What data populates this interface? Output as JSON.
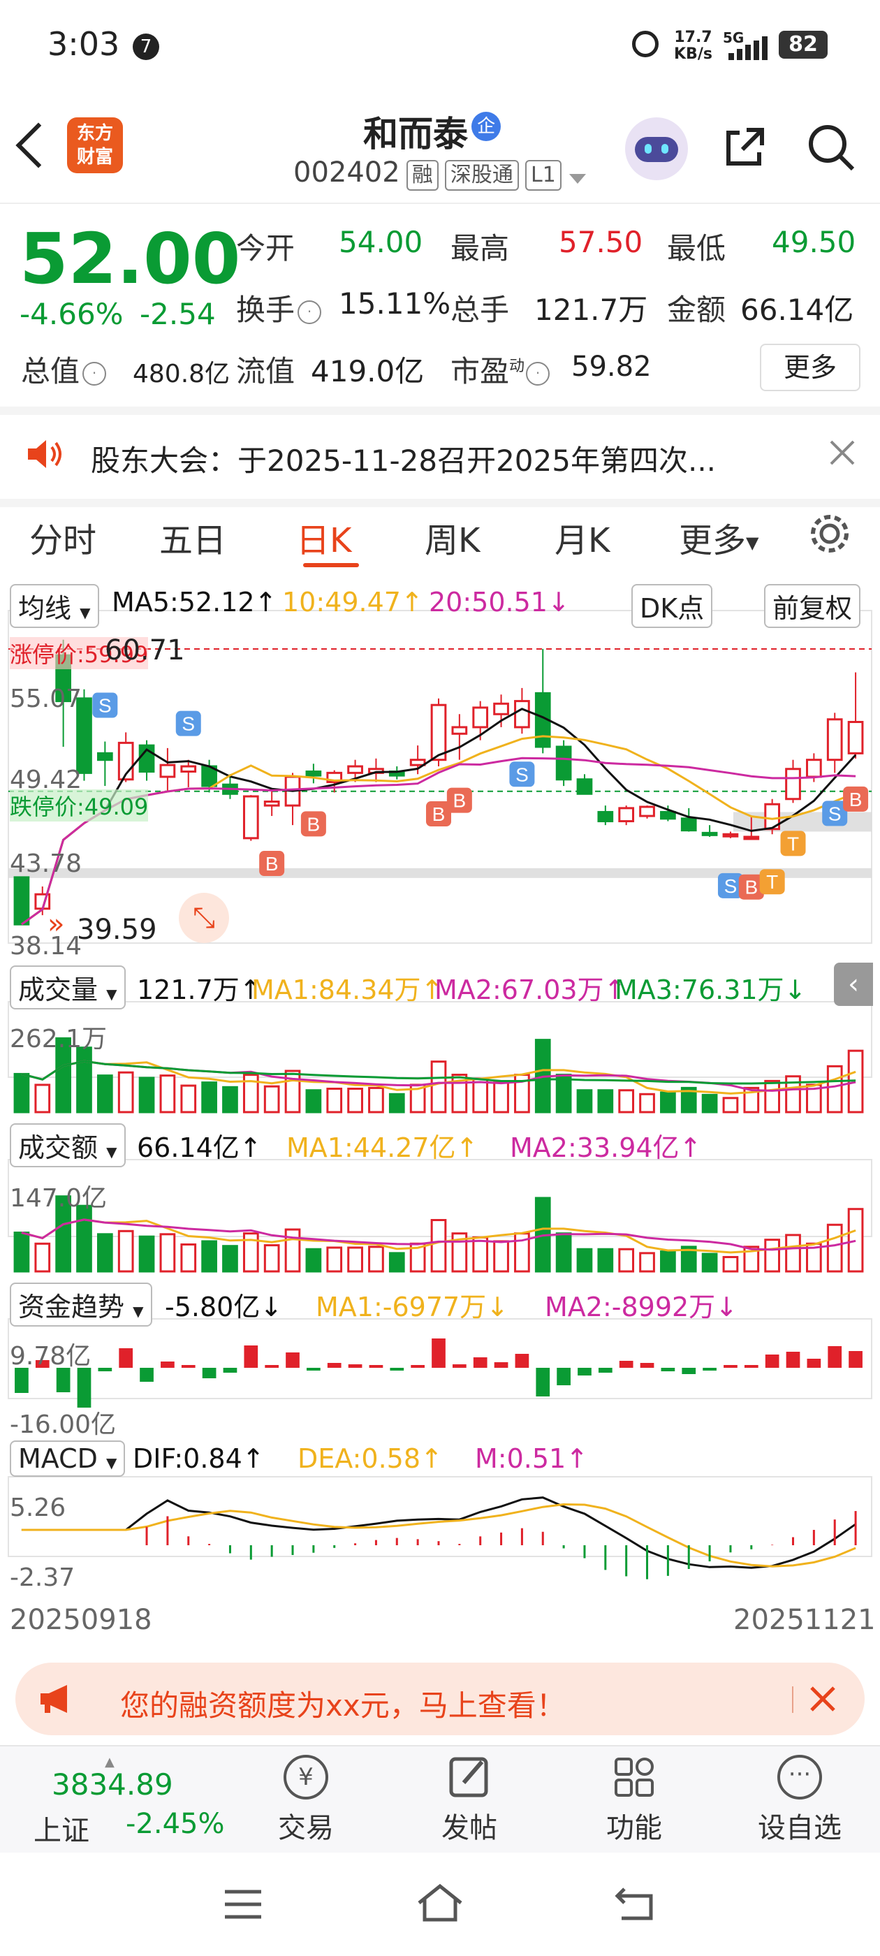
{
  "status_bar": {
    "time": "3:03",
    "notif_count": "7",
    "net_speed": "17.7",
    "net_unit": "KB/s",
    "network": "5G",
    "battery": "82"
  },
  "header": {
    "logo_line1": "东方",
    "logo_line2": "财富",
    "stock_name": "和而泰",
    "name_badge": "企",
    "stock_code": "002402",
    "tags": [
      "融",
      "深股通",
      "L1"
    ]
  },
  "quote": {
    "price": "52.00",
    "change_pct": "-4.66%",
    "change": "-2.54",
    "open_label": "今开",
    "open": "54.00",
    "high_label": "最高",
    "high": "57.50",
    "low_label": "最低",
    "low": "49.50",
    "turnover_label": "换手",
    "turnover": "15.11%",
    "volume_label": "总手",
    "volume": "121.7万",
    "amount_label": "金额",
    "amount": "66.14亿",
    "mcap_label": "总值",
    "mcap": "480.8亿",
    "float_label": "流值",
    "float": "419.0亿",
    "pe_label": "市盈",
    "pe_sup": "动",
    "pe": "59.82",
    "more_button": "更多"
  },
  "notice": {
    "text": "股东大会：于2025-11-28召开2025年第四次..."
  },
  "tabs": [
    "分时",
    "五日",
    "日K",
    "周K",
    "月K",
    "更多"
  ],
  "active_tab": "日K",
  "kchart": {
    "ma_selector": "均线",
    "ma5": "MA5:52.12",
    "ma5_arrow": "↑",
    "ma10": "10:49.47",
    "ma10_arrow": "↑",
    "ma20": "20:50.51",
    "ma20_arrow": "↓",
    "dk_button": "DK点",
    "adjust_button": "前复权",
    "limit_up_label": "涨停价:59.99",
    "limit_down_label": "跌停价:49.09",
    "y_ticks": [
      "60.71",
      "55.07",
      "49.42",
      "43.78",
      "38.14"
    ],
    "high_mark": "60.71",
    "low_mark": "39.59"
  },
  "volume_panel": {
    "selector": "成交量",
    "value": "121.7万",
    "value_arrow": "↑",
    "ma1": "MA1:84.34万",
    "ma1_arrow": "↑",
    "ma2": "MA2:67.03万",
    "ma2_arrow": "↑",
    "ma3": "MA3:76.31万",
    "ma3_arrow": "↓",
    "top_tick": "262.1万"
  },
  "amount_panel": {
    "selector": "成交额",
    "value": "66.14亿",
    "value_arrow": "↑",
    "ma1": "MA1:44.27亿",
    "ma1_arrow": "↑",
    "ma2": "MA2:33.94亿",
    "ma2_arrow": "↑",
    "top_tick": "147.0亿"
  },
  "fund_panel": {
    "selector": "资金趋势",
    "value": "-5.80亿",
    "value_arrow": "↓",
    "ma1": "MA1:-6977万",
    "ma1_arrow": "↓",
    "ma2": "MA2:-8992万",
    "ma2_arrow": "↓",
    "top_tick": "9.78亿",
    "bottom_tick": "-16.00亿"
  },
  "macd_panel": {
    "selector": "MACD",
    "dif": "DIF:0.84",
    "dif_arrow": "↑",
    "dea": "DEA:0.58",
    "dea_arrow": "↑",
    "m": "M:0.51",
    "m_arrow": "↑",
    "top_tick": "5.26",
    "bottom_tick": "-2.37"
  },
  "date_range": {
    "start": "20250918",
    "end": "20251121"
  },
  "promo": {
    "text": "您的融资额度为xx元，马上查看！"
  },
  "bottom_nav": {
    "index_value": "3834.89",
    "index_name": "上证",
    "index_change": "-2.45%",
    "items": [
      "交易",
      "发帖",
      "功能",
      "设自选"
    ]
  },
  "colors": {
    "up": "#e0212a",
    "down": "#0a9b34",
    "accent": "#e8431b",
    "ma5": "#111111",
    "ma10": "#f0b21d",
    "ma20": "#cc2aa0"
  },
  "chart_data": {
    "type": "candlestick",
    "x_start": "20250918",
    "x_end": "20251121",
    "ohlc": [
      [
        42.5,
        42.5,
        38.9,
        38.9
      ],
      [
        40.1,
        41.8,
        39.6,
        41.2
      ],
      [
        59.5,
        60.7,
        52.5,
        56.0
      ],
      [
        56.2,
        56.9,
        49.9,
        50.5
      ],
      [
        52.0,
        52.9,
        49.5,
        51.5
      ],
      [
        50.0,
        53.6,
        49.8,
        52.8
      ],
      [
        52.6,
        53.0,
        49.9,
        50.6
      ],
      [
        50.2,
        52.4,
        49.0,
        51.1
      ],
      [
        50.6,
        51.5,
        49.4,
        51.0
      ],
      [
        51.0,
        51.5,
        49.0,
        49.5
      ],
      [
        49.6,
        50.4,
        48.5,
        48.9
      ],
      [
        45.5,
        48.8,
        45.3,
        48.7
      ],
      [
        48.0,
        49.2,
        47.2,
        48.3
      ],
      [
        48.0,
        50.5,
        46.5,
        50.2
      ],
      [
        50.6,
        51.2,
        49.7,
        50.3
      ],
      [
        49.8,
        50.7,
        49.0,
        50.5
      ],
      [
        50.5,
        51.5,
        49.8,
        51.0
      ],
      [
        50.5,
        51.6,
        49.8,
        50.8
      ],
      [
        50.6,
        51.0,
        50.0,
        50.3
      ],
      [
        51.1,
        52.6,
        50.4,
        51.5
      ],
      [
        51.5,
        56.2,
        51.0,
        55.7
      ],
      [
        53.5,
        55.0,
        51.5,
        54.0
      ],
      [
        54.0,
        56.0,
        53.0,
        55.5
      ],
      [
        55.0,
        56.5,
        54.0,
        55.8
      ],
      [
        54.0,
        57.0,
        53.5,
        56.0
      ],
      [
        56.6,
        60.0,
        52.0,
        52.5
      ],
      [
        52.5,
        53.0,
        49.5,
        50.0
      ],
      [
        50.0,
        50.4,
        48.9,
        48.9
      ],
      [
        47.5,
        48.0,
        46.5,
        46.8
      ],
      [
        46.8,
        48.0,
        46.5,
        47.8
      ],
      [
        47.2,
        48.0,
        47.0,
        47.9
      ],
      [
        47.5,
        48.0,
        46.8,
        47.0
      ],
      [
        47.0,
        47.8,
        46.0,
        46.1
      ],
      [
        45.9,
        46.5,
        45.6,
        45.8
      ],
      [
        45.8,
        46.0,
        45.5,
        45.8
      ],
      [
        45.6,
        47.2,
        45.4,
        45.6
      ],
      [
        46.2,
        48.5,
        45.8,
        48.1
      ],
      [
        48.5,
        51.5,
        48.2,
        50.8
      ],
      [
        50.2,
        52.0,
        49.8,
        51.5
      ],
      [
        51.5,
        55.1,
        50.5,
        54.6
      ],
      [
        52.0,
        58.2,
        51.6,
        54.4
      ]
    ]
  }
}
